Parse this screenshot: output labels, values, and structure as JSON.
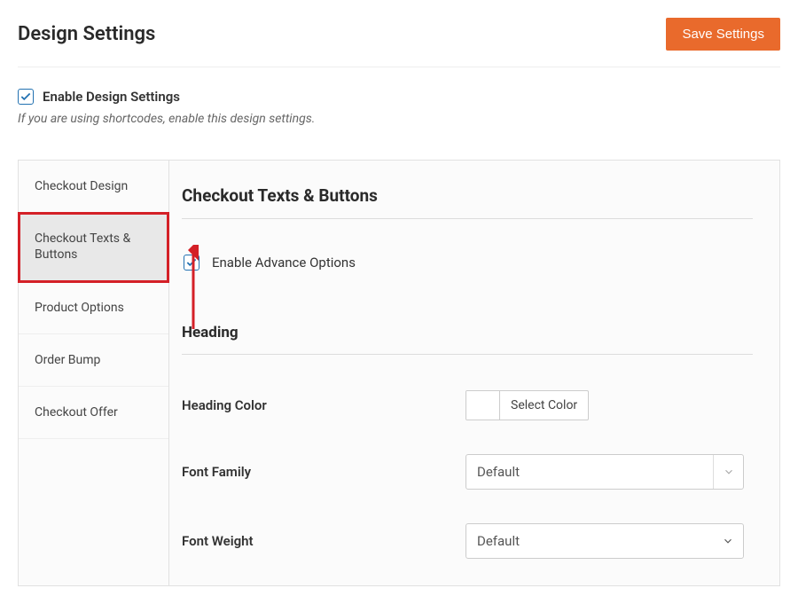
{
  "header": {
    "title": "Design Settings",
    "save_button": "Save Settings"
  },
  "enable": {
    "checked": true,
    "label": "Enable Design Settings",
    "helper": "If you are using shortcodes, enable this design settings."
  },
  "sidebar": {
    "items": [
      {
        "label": "Checkout Design"
      },
      {
        "label": "Checkout Texts & Buttons"
      },
      {
        "label": "Product Options"
      },
      {
        "label": "Order Bump"
      },
      {
        "label": "Checkout Offer"
      }
    ],
    "active_index": 1
  },
  "content": {
    "section_title": "Checkout Texts & Buttons",
    "advance": {
      "checked": true,
      "label": "Enable Advance Options"
    },
    "sub_heading": "Heading",
    "fields": {
      "heading_color": {
        "label": "Heading Color",
        "button": "Select Color"
      },
      "font_family": {
        "label": "Font Family",
        "value": "Default"
      },
      "font_weight": {
        "label": "Font Weight",
        "value": "Default"
      }
    }
  }
}
